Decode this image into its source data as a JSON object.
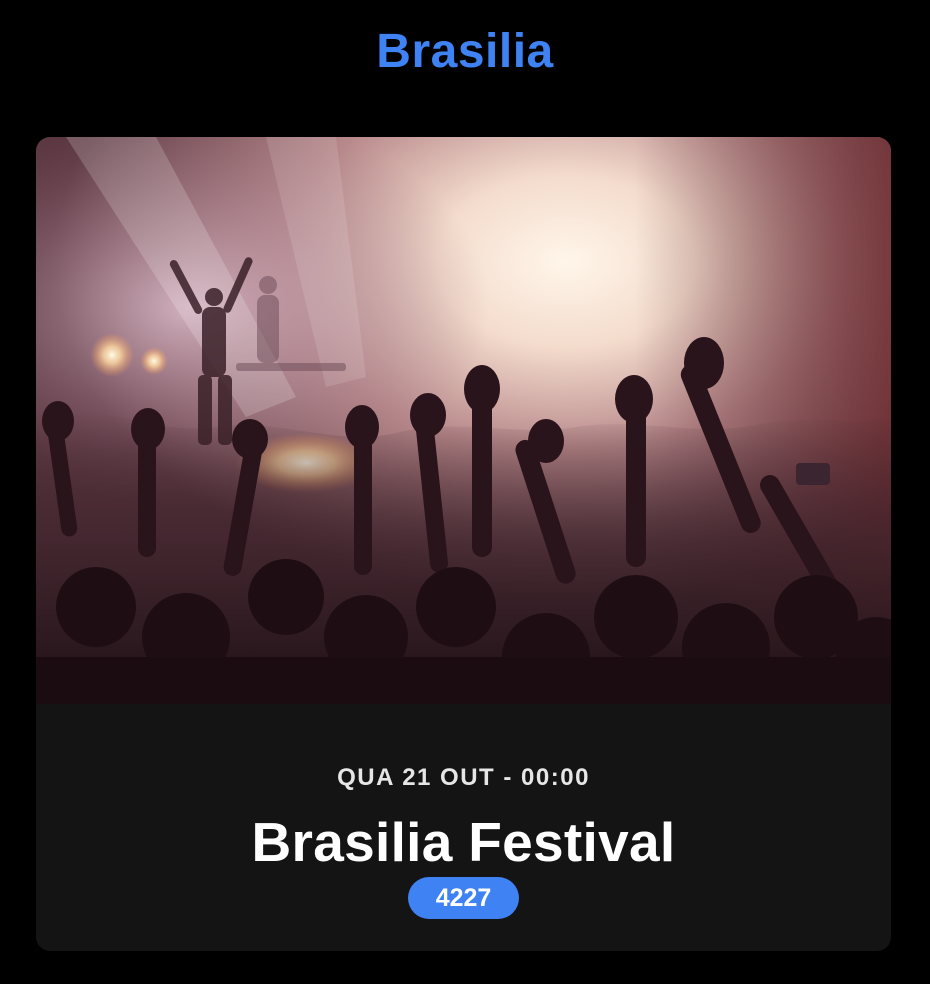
{
  "header": {
    "title": "Brasilia"
  },
  "event_card": {
    "image_alt": "concert-crowd-photo",
    "date_time": "QUA 21 OUT - 00:00",
    "title": "Brasilia Festival",
    "badge": "4227"
  },
  "colors": {
    "accent": "#3f82f4",
    "background": "#000000",
    "card_background": "#141414"
  }
}
